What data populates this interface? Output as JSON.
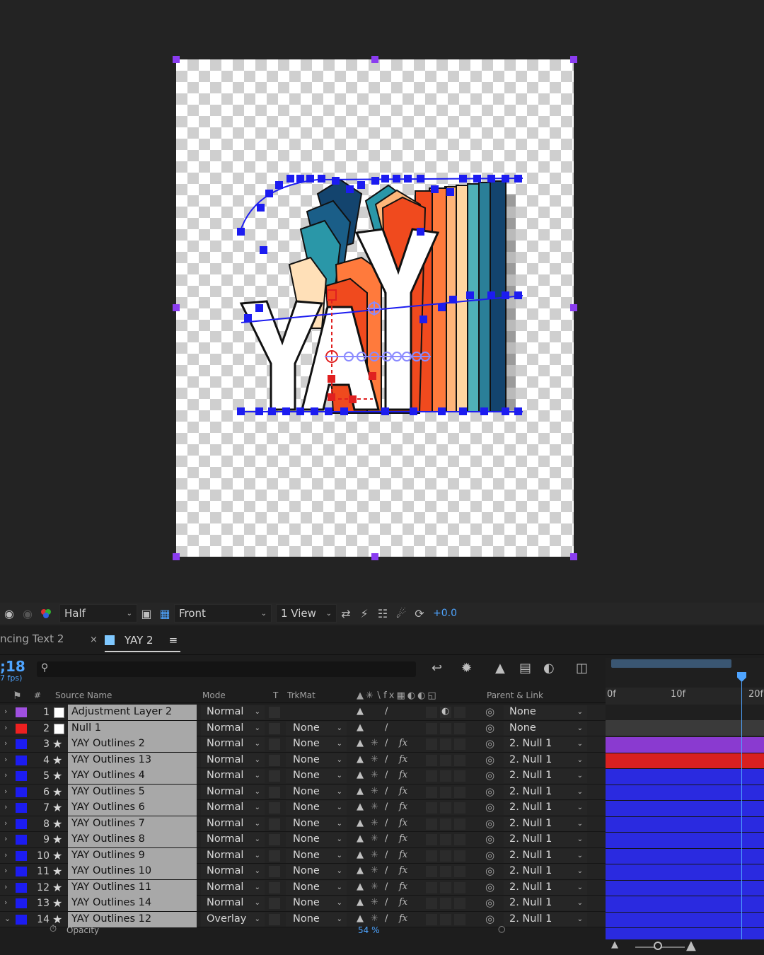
{
  "viewer_toolbar": {
    "resolution": "Half",
    "view_angle": "Front",
    "view_layout": "1 View",
    "exposure": "+0.0"
  },
  "tabs": {
    "inactive_label": "ncing Text 2",
    "active_label": "YAY 2",
    "active_color": "#7fc8ff"
  },
  "timeline": {
    "timecode": ";18",
    "fps": "7 fps)",
    "search_placeholder": ""
  },
  "columns": {
    "num": "#",
    "source_name": "Source Name",
    "mode": "Mode",
    "t": "T",
    "trkmat": "TrkMat",
    "parent": "Parent & Link"
  },
  "layers": [
    {
      "num": "1",
      "name": "Adjustment Layer 2",
      "mode": "Normal",
      "trkmat": "",
      "parent": "None",
      "color": "#a050e0",
      "bar": "#8a3ad0",
      "type": "solid"
    },
    {
      "num": "2",
      "name": "Null 1",
      "mode": "Normal",
      "trkmat": "None",
      "parent": "None",
      "color": "#ee2020",
      "bar": "#d82020",
      "type": "solid"
    },
    {
      "num": "3",
      "name": "YAY Outlines 2",
      "mode": "Normal",
      "trkmat": "None",
      "parent": "2. Null 1",
      "color": "#1c1cf0",
      "bar": "#2a2ae0",
      "type": "shape"
    },
    {
      "num": "4",
      "name": "YAY Outlines 13",
      "mode": "Normal",
      "trkmat": "None",
      "parent": "2. Null 1",
      "color": "#1c1cf0",
      "bar": "#2a2ae0",
      "type": "shape"
    },
    {
      "num": "5",
      "name": "YAY Outlines 4",
      "mode": "Normal",
      "trkmat": "None",
      "parent": "2. Null 1",
      "color": "#1c1cf0",
      "bar": "#2a2ae0",
      "type": "shape"
    },
    {
      "num": "6",
      "name": "YAY Outlines 5",
      "mode": "Normal",
      "trkmat": "None",
      "parent": "2. Null 1",
      "color": "#1c1cf0",
      "bar": "#2a2ae0",
      "type": "shape"
    },
    {
      "num": "7",
      "name": "YAY Outlines 6",
      "mode": "Normal",
      "trkmat": "None",
      "parent": "2. Null 1",
      "color": "#1c1cf0",
      "bar": "#2a2ae0",
      "type": "shape"
    },
    {
      "num": "8",
      "name": "YAY Outlines 7",
      "mode": "Normal",
      "trkmat": "None",
      "parent": "2. Null 1",
      "color": "#1c1cf0",
      "bar": "#2a2ae0",
      "type": "shape"
    },
    {
      "num": "9",
      "name": "YAY Outlines 8",
      "mode": "Normal",
      "trkmat": "None",
      "parent": "2. Null 1",
      "color": "#1c1cf0",
      "bar": "#2a2ae0",
      "type": "shape"
    },
    {
      "num": "10",
      "name": "YAY Outlines 9",
      "mode": "Normal",
      "trkmat": "None",
      "parent": "2. Null 1",
      "color": "#1c1cf0",
      "bar": "#2a2ae0",
      "type": "shape"
    },
    {
      "num": "11",
      "name": "YAY Outlines 10",
      "mode": "Normal",
      "trkmat": "None",
      "parent": "2. Null 1",
      "color": "#1c1cf0",
      "bar": "#2a2ae0",
      "type": "shape"
    },
    {
      "num": "12",
      "name": "YAY Outlines 11",
      "mode": "Normal",
      "trkmat": "None",
      "parent": "2. Null 1",
      "color": "#1c1cf0",
      "bar": "#2a2ae0",
      "type": "shape"
    },
    {
      "num": "13",
      "name": "YAY Outlines 14",
      "mode": "Normal",
      "trkmat": "None",
      "parent": "2. Null 1",
      "color": "#1c1cf0",
      "bar": "#2a2ae0",
      "type": "shape"
    },
    {
      "num": "14",
      "name": "YAY Outlines 12",
      "mode": "Overlay",
      "trkmat": "None",
      "parent": "2. Null 1",
      "color": "#1c1cf0",
      "bar": "#2a2ae0",
      "type": "shape"
    }
  ],
  "property_row": {
    "name": "Opacity",
    "value": "54 %"
  },
  "ruler": {
    "ticks": [
      "0f",
      "10f",
      "20f"
    ]
  },
  "artwork": {
    "text": "YAY",
    "palette": [
      "#f04a1e",
      "#ff7a3c",
      "#ffb67a",
      "#ffe0b8",
      "#2a97a8",
      "#1a5e88",
      "#0c2c5c"
    ]
  },
  "colors": {
    "accent": "#4ea4ff",
    "handle": "#8a3cf0",
    "path": "#1c1cf0",
    "null_path": "#e02020"
  }
}
